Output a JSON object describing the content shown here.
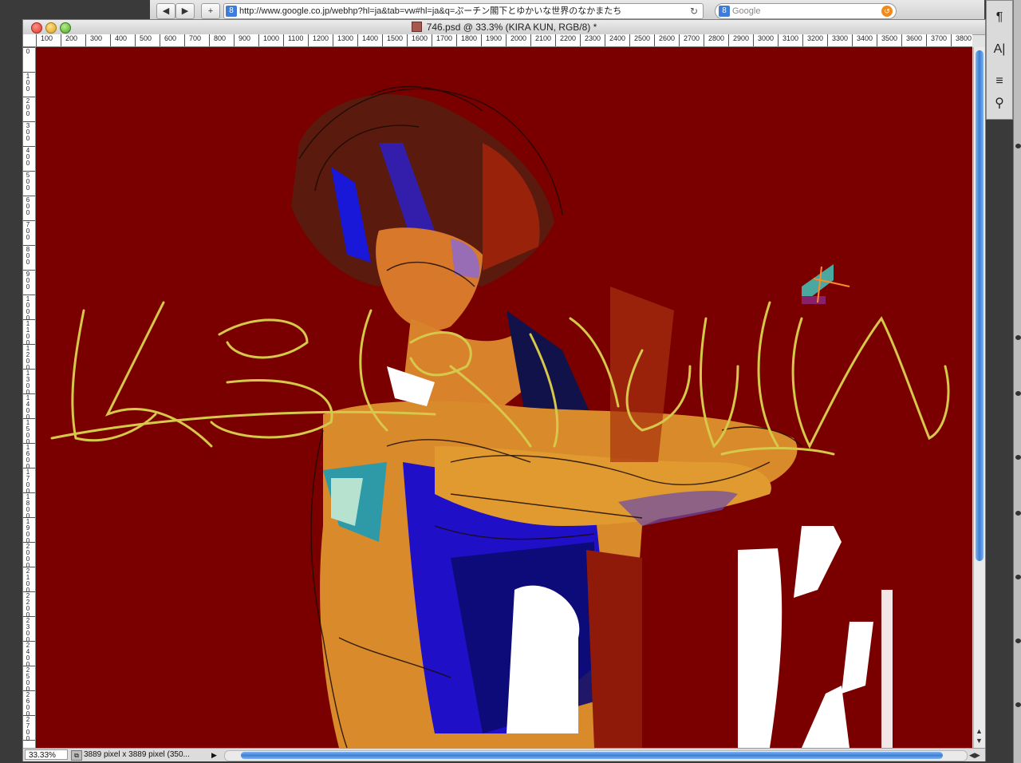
{
  "browser": {
    "back_label": "◀",
    "forward_label": "▶",
    "add_label": "+",
    "url": "http://www.google.co.jp/webhp?hl=ja&tab=vw#hl=ja&q=ぷーチン閣下とゆかいな世界のなかまたち",
    "url_badge": "8",
    "reload_glyph": "↻",
    "search_placeholder": "Google",
    "search_badge": "8"
  },
  "document": {
    "title": "746.psd @ 33.3% (KIRA      KUN, RGB/8) *",
    "zoom": "33.33%",
    "info": "3889 pixel x 3889 pixel (350...",
    "ruler_h_labels": [
      "100",
      "200",
      "300",
      "400",
      "500",
      "600",
      "700",
      "800",
      "900",
      "1000",
      "1100",
      "1200",
      "1300",
      "1400",
      "1500",
      "1600",
      "1700",
      "1800",
      "1900",
      "2000",
      "2100",
      "2200",
      "2300",
      "2400",
      "2500",
      "2600",
      "2700",
      "2800",
      "2900",
      "3000",
      "3100",
      "3200",
      "3300",
      "3400",
      "3500",
      "3600",
      "3700",
      "3800"
    ],
    "ruler_v_labels": [
      "0",
      "100",
      "200",
      "300",
      "400",
      "500",
      "600",
      "700",
      "800",
      "900",
      "1000",
      "1100",
      "1200",
      "1300",
      "1400",
      "1500",
      "1600",
      "1700",
      "1800",
      "1900",
      "2000",
      "2100",
      "2200",
      "2300",
      "2400",
      "2500",
      "2600",
      "2700"
    ]
  },
  "panels": {
    "paragraph_icon": "¶",
    "character_icon": "A|",
    "adjust_icon": "≡",
    "tool_icon": "⚲"
  },
  "colors": {
    "canvas_bg": "#7a0000",
    "scroll_accent": "#3c7fd7"
  }
}
